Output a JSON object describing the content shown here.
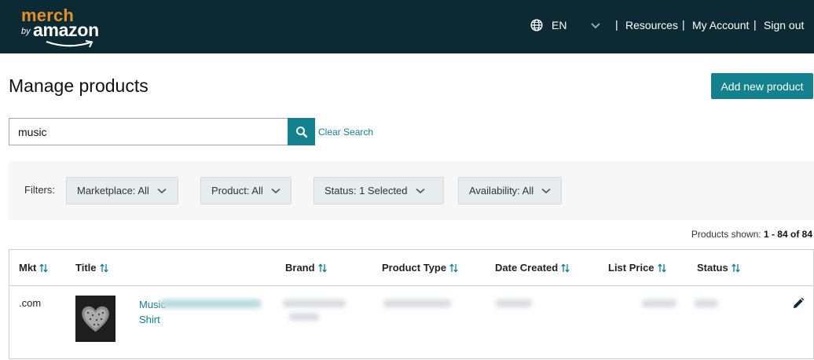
{
  "header": {
    "logo_merch": "merch",
    "logo_by": "by",
    "logo_amazon": "amazon",
    "language": "EN",
    "nav": [
      {
        "label": "Resources"
      },
      {
        "label": "My Account"
      },
      {
        "label": "Sign out"
      }
    ],
    "separator": "|"
  },
  "page": {
    "title": "Manage products",
    "add_button": "Add new product"
  },
  "search": {
    "value": "music",
    "clear_label": "Clear Search"
  },
  "filters": {
    "label": "Filters:",
    "items": [
      {
        "label": "Marketplace: All"
      },
      {
        "label": "Product: All"
      },
      {
        "label": "Status: 1 Selected"
      },
      {
        "label": "Availability: All"
      }
    ]
  },
  "products_shown": {
    "prefix": "Products shown:",
    "range": "1 - 84 of 84"
  },
  "table": {
    "columns": [
      "Mkt",
      "Title",
      "Brand",
      "Product Type",
      "Date Created",
      "List Price",
      "Status"
    ],
    "rows": [
      {
        "mkt": ".com",
        "title_line1": "Music",
        "title_line2": "Shirt"
      }
    ]
  },
  "colors": {
    "header_bg": "#0b2a34",
    "accent": "#13818e",
    "logo_orange": "#e39128"
  },
  "icons": [
    "globe-icon",
    "chevron-down-icon",
    "search-icon",
    "sort-icon",
    "edit-pencil-icon"
  ]
}
